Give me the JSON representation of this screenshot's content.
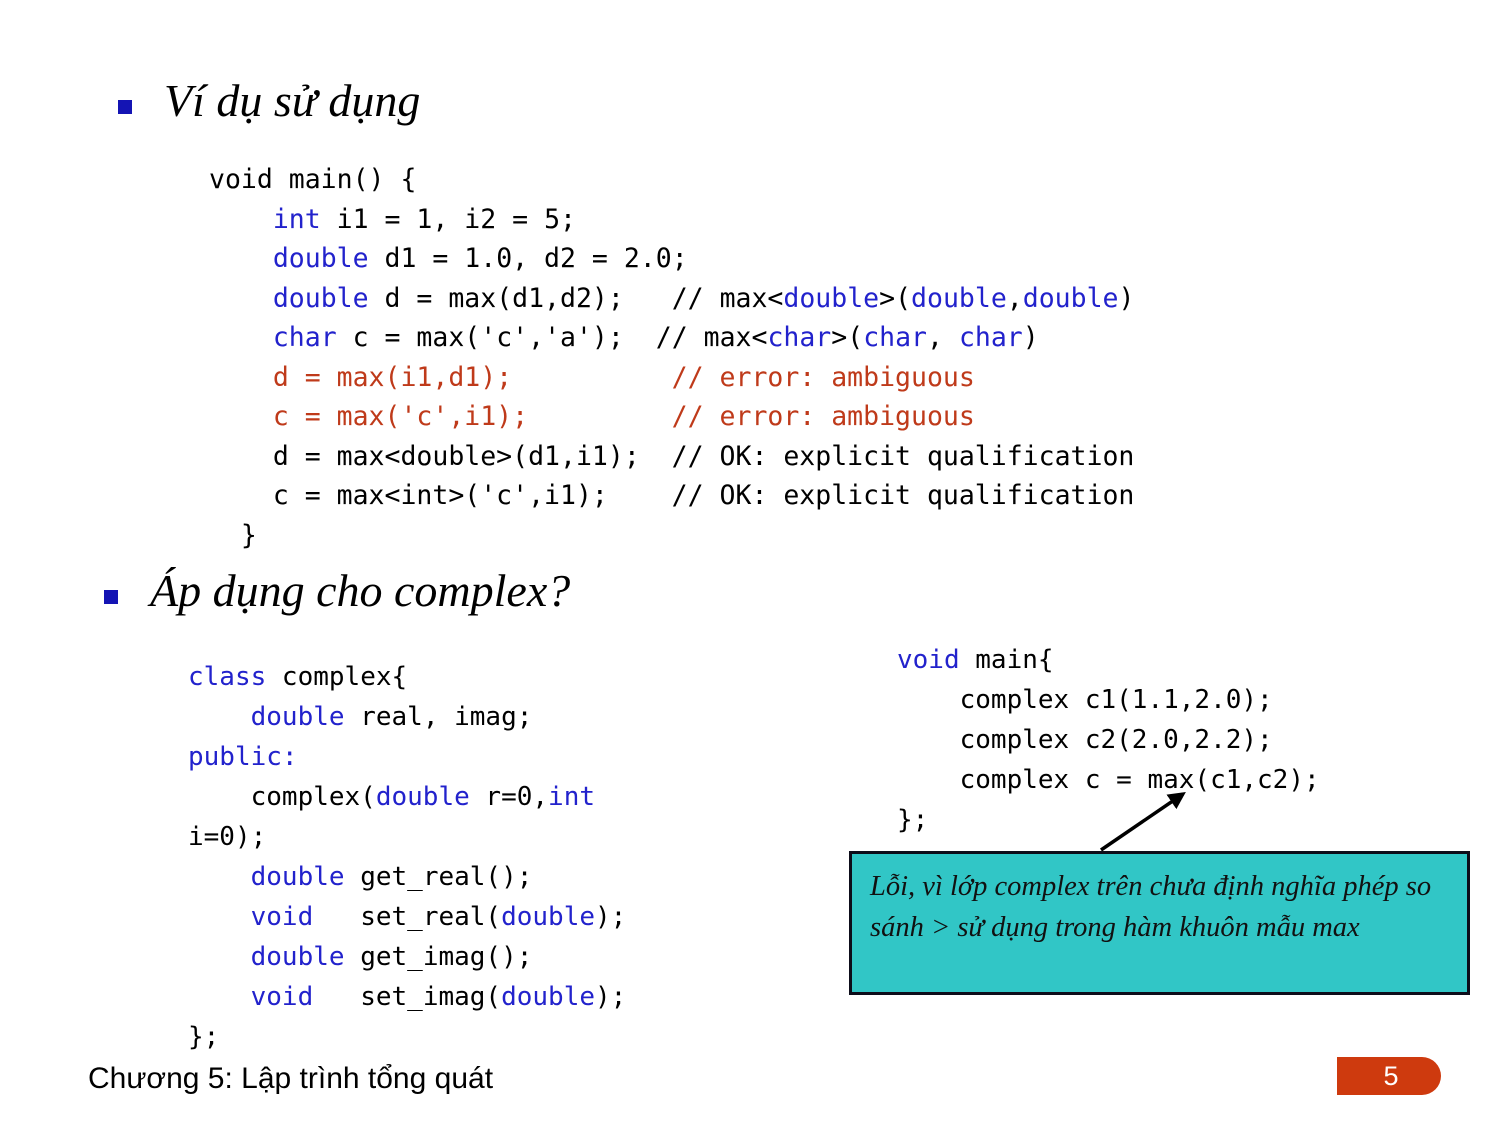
{
  "slide": {
    "headings": [
      {
        "text": "Ví dụ sử dụng"
      },
      {
        "text": "Áp dụng cho complex?"
      }
    ],
    "code_main": {
      "lines": [
        "void main() {",
        "    int i1 = 1, i2 = 5;",
        "    double d1 = 1.0, d2 = 2.0;",
        "    double d = max(d1,d2);   // max<double>(double,double)",
        "    char c = max('c','a');  // max<char>(char, char)",
        "    d = max(i1,d1);          // error: ambiguous",
        "    c = max('c',i1);         // error: ambiguous",
        "    d = max<double>(d1,i1);  // OK: explicit qualification",
        "    c = max<int>('c',i1);    // OK: explicit qualification",
        "  }"
      ]
    },
    "code_complex_class": {
      "lines": [
        "class complex{",
        "    double real, imag;",
        "public:",
        "    complex(double r=0,int",
        "i=0);",
        "    double get_real();",
        "    void   set_real(double);",
        "    double get_imag();",
        "    void   set_imag(double);",
        "};"
      ]
    },
    "code_complex_main": {
      "lines": [
        "void main{",
        "    complex c1(1.1,2.0);",
        "    complex c2(2.0,2.2);",
        "    complex c = max(c1,c2);",
        "};"
      ]
    },
    "callout": {
      "text": "Lỗi, vì lớp complex trên chưa định nghĩa phép so sánh > sử dụng trong hàm khuôn mẫu max",
      "background_color": "#31C6C6",
      "border_color": "#0D0D1A"
    },
    "footer": {
      "chapter_label": "Chương 5: Lập trình tổng quát",
      "page_number": "5",
      "badge_color": "#CE3A0E"
    },
    "colors": {
      "keyword_blue": "#2222CC",
      "error_red": "#BF3A1A",
      "bullet_blue": "#1414B4",
      "text_black": "#000000"
    }
  }
}
